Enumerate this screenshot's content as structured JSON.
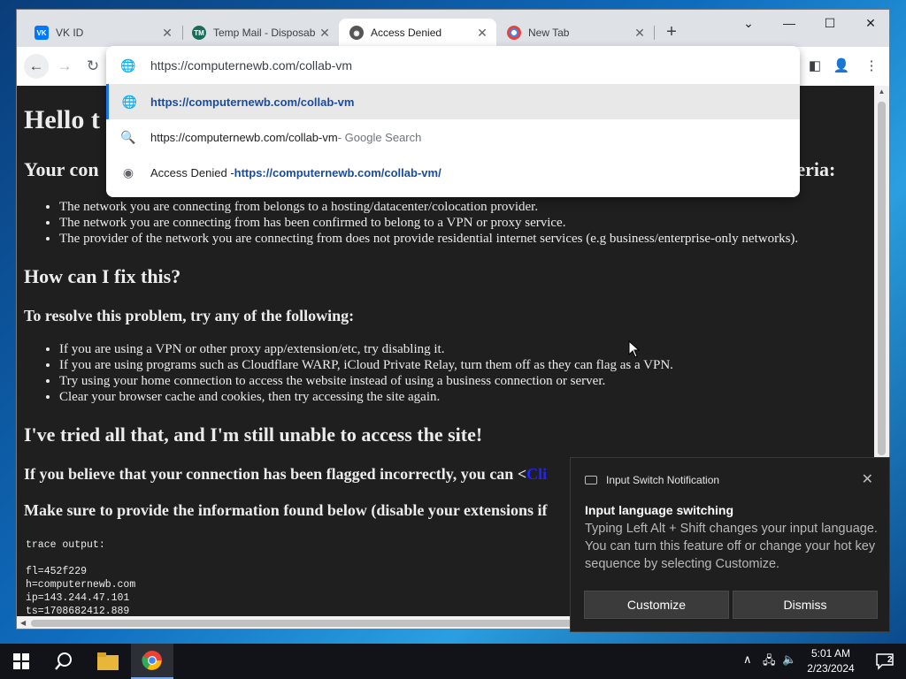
{
  "tabs": [
    {
      "title": "VK ID",
      "icon": "vk-logo-icon",
      "active": false
    },
    {
      "title": "Temp Mail - Disposab",
      "icon": "tempmail-logo-icon",
      "active": false
    },
    {
      "title": "Access Denied",
      "icon": "access-denied-favicon-icon",
      "active": true
    },
    {
      "title": "New Tab",
      "icon": "chrome-icon",
      "active": false
    }
  ],
  "window_controls": {
    "dropdown": "⌄",
    "minimize": "—",
    "maximize": "☐",
    "close": "✕"
  },
  "omnibox": {
    "input_value": "https://computernewb.com/collab-vm",
    "suggestions": [
      {
        "icon": "globe-icon",
        "prefix": "",
        "text": "https://computernewb.com/collab-vm",
        "suffix": ""
      },
      {
        "icon": "search-icon",
        "prefix": "https://computernewb.com/collab-vm",
        "text": "",
        "suffix": " - Google Search"
      },
      {
        "icon": "access-denied-favicon-icon",
        "prefix": "Access Denied - ",
        "text": "https://computernewb.com/collab-vm/",
        "suffix": ""
      }
    ]
  },
  "page": {
    "h1": "Hello t",
    "h2_criteria_left": "Your con",
    "h2_criteria_right": "teria:",
    "criteria_items": [
      "The network you are connecting from belongs to a hosting/datacenter/colocation provider.",
      "The network you are connecting from has been confirmed to belong to a VPN or proxy service.",
      "The provider of the network you are connecting from does not provide residential internet services (e.g business/enterprise-only networks)."
    ],
    "fix_heading": "How can I fix this?",
    "resolve_heading": "To resolve this problem, try any of the following:",
    "fix_items": [
      "If you are using a VPN or other proxy app/extension/etc, try disabling it.",
      "If you are using programs such as Cloudflare WARP, iCloud Private Relay, turn them off as they can flag as a VPN.",
      "Try using your home connection to access the website instead of using a business connection or server.",
      "Clear your browser cache and cookies, then try accessing the site again."
    ],
    "tried_heading": "I've tried all that, and I'm still unable to access the site!",
    "flagged_text": "If you believe that your connection has been flagged incorrectly, you can <",
    "flagged_link": "Cli",
    "provide_text": "Make sure to provide the information found below (disable your extensions if",
    "trace": "trace output:\n\nfl=452f229\nh=computernewb.com\nip=143.244.47.101\nts=1708682412.889"
  },
  "notification": {
    "app_name": "Input Switch Notification",
    "title": "Input language switching",
    "body": "Typing Left Alt + Shift changes your input language. You can turn this feature off or change your hot key sequence by selecting Customize.",
    "customize_label": "Customize",
    "dismiss_label": "Dismiss"
  },
  "taskbar": {
    "time": "5:01 AM",
    "date": "2/23/2024",
    "notification_count": "2"
  },
  "colors": {
    "accent": "#1a73e8",
    "page_bg": "#1f1f1f",
    "link": "#2323ff",
    "taskbar": "#111319"
  }
}
